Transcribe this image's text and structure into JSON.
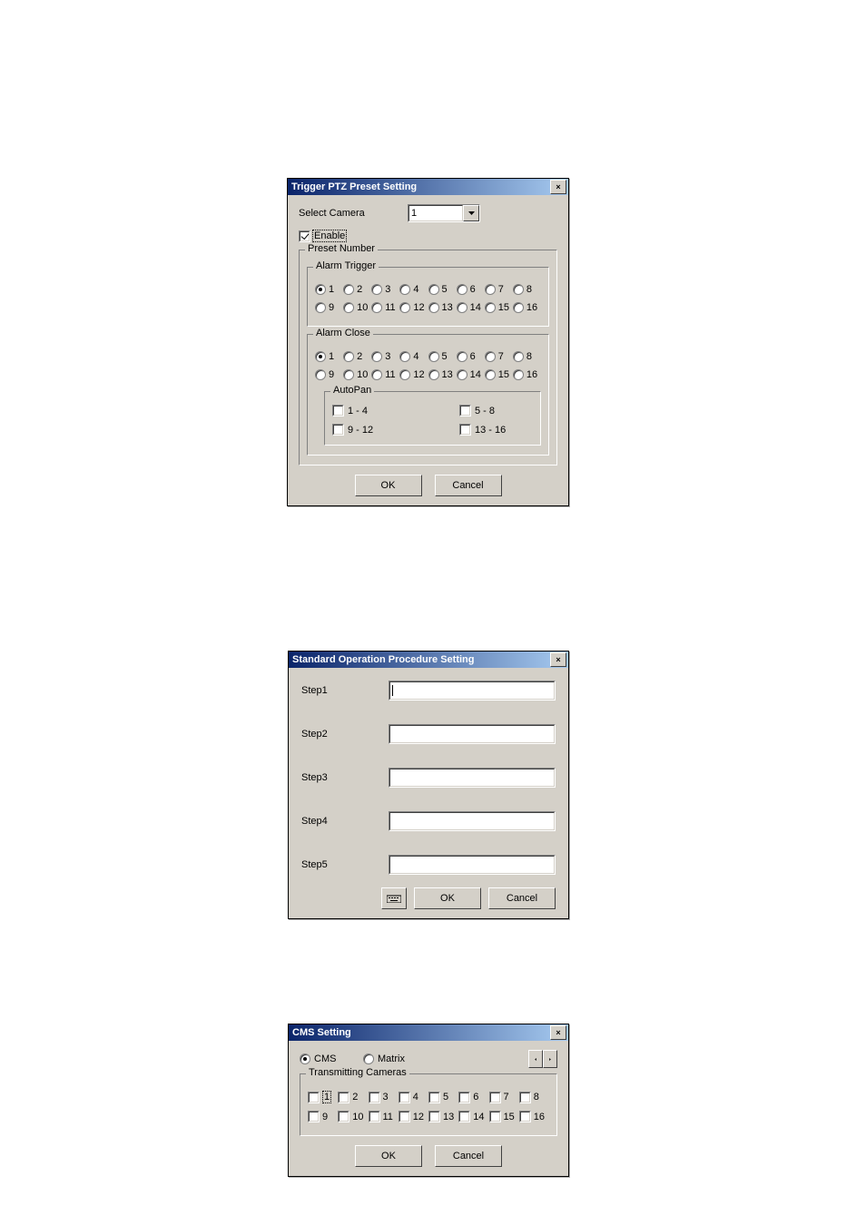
{
  "dialog1": {
    "title": "Trigger PTZ Preset Setting",
    "select_camera_label": "Select Camera",
    "select_camera_value": "1",
    "enable_label": "Enable",
    "enable_checked": true,
    "preset_number_label": "Preset Number",
    "alarm_trigger_label": "Alarm Trigger",
    "alarm_close_label": "Alarm Close",
    "autopan_label": "AutoPan",
    "autopan": {
      "a": "1 - 4",
      "b": "5 - 8",
      "c": "9 - 12",
      "d": "13 - 16"
    },
    "trigger_selected": "1",
    "close_selected": "1",
    "ok": "OK",
    "cancel": "Cancel"
  },
  "dialog2": {
    "title": "Standard Operation Procedure Setting",
    "step1": "Step1",
    "step2": "Step2",
    "step3": "Step3",
    "step4": "Step4",
    "step5": "Step5",
    "ok": "OK",
    "cancel": "Cancel"
  },
  "dialog3": {
    "title": "CMS Setting",
    "cms_label": "CMS",
    "matrix_label": "Matrix",
    "mode_selected": "cms",
    "transmitting_label": "Transmitting Cameras",
    "ok": "OK",
    "cancel": "Cancel"
  },
  "numbers": {
    "n1": "1",
    "n2": "2",
    "n3": "3",
    "n4": "4",
    "n5": "5",
    "n6": "6",
    "n7": "7",
    "n8": "8",
    "n9": "9",
    "n10": "10",
    "n11": "11",
    "n12": "12",
    "n13": "13",
    "n14": "14",
    "n15": "15",
    "n16": "16"
  }
}
